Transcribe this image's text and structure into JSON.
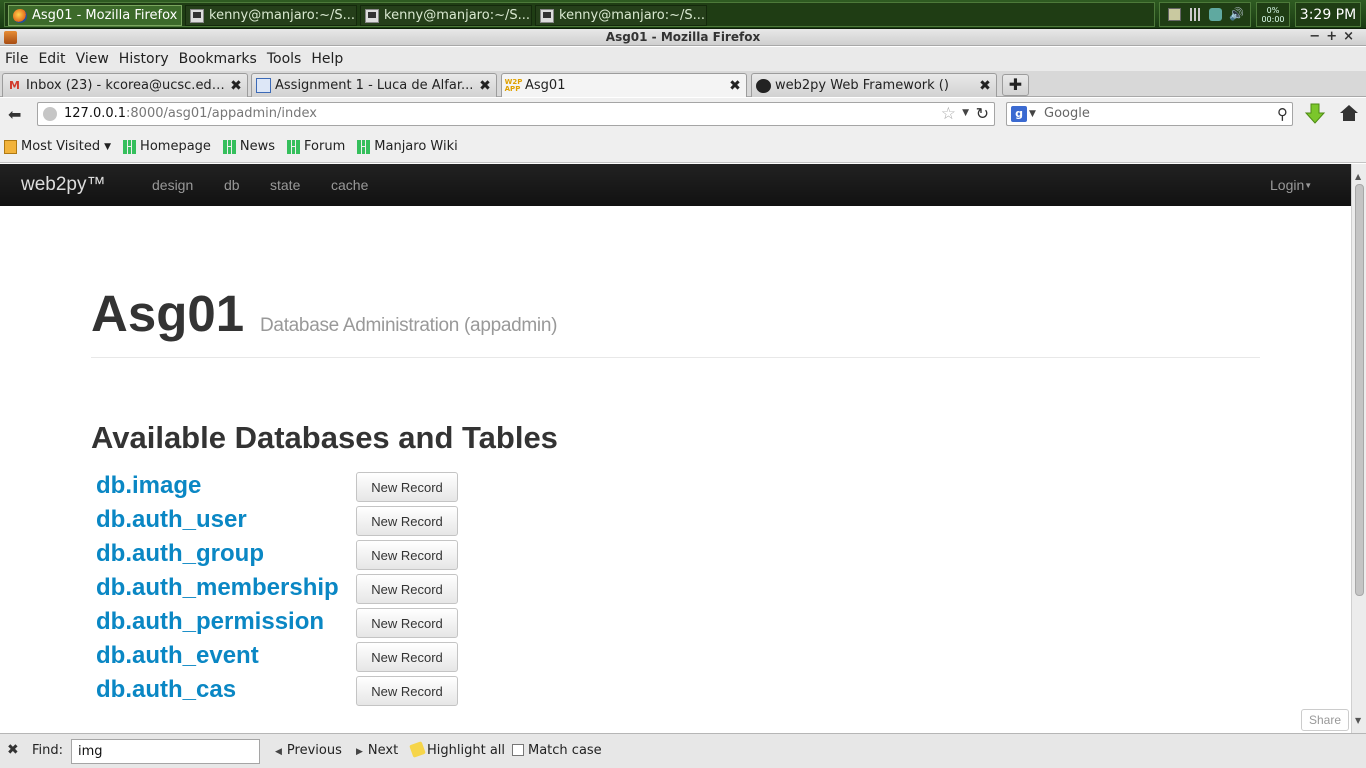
{
  "taskbar": {
    "tasks": [
      {
        "label": "Asg01 - Mozilla Firefox"
      },
      {
        "label": "kenny@manjaro:~/S..."
      },
      {
        "label": "kenny@manjaro:~/S..."
      },
      {
        "label": "kenny@manjaro:~/S..."
      }
    ],
    "load_top": "0%",
    "load_bottom": "00:00",
    "clock": "3:29 PM"
  },
  "window": {
    "title": "Asg01 - Mozilla Firefox",
    "controls": {
      "minimize": "−",
      "maximize": "+",
      "close": "×"
    }
  },
  "menubar": {
    "items": [
      "File",
      "Edit",
      "View",
      "History",
      "Bookmarks",
      "Tools",
      "Help"
    ]
  },
  "tabs": [
    {
      "label": "Inbox (23) - kcorea@ucsc.edu...",
      "icon": "gmail-icon"
    },
    {
      "label": "Assignment 1 - Luca de Alfar...",
      "icon": "document-icon"
    },
    {
      "label": "Asg01",
      "icon": "web2py-icon"
    },
    {
      "label": "web2py Web Framework ()",
      "icon": "github-icon"
    }
  ],
  "navbar": {
    "url_host": "127.0.0.1",
    "url_path": ":8000/asg01/appadmin/index",
    "search_placeholder": "Google"
  },
  "bookmarks": {
    "most_visited": "Most Visited",
    "items": [
      "Homepage",
      "News",
      "Forum",
      "Manjaro Wiki"
    ]
  },
  "webapp": {
    "brand": "web2py™",
    "nav": [
      "design",
      "db",
      "state",
      "cache"
    ],
    "login": "Login",
    "title": "Asg01",
    "subtitle": "Database Administration (appadmin)",
    "section_heading": "Available Databases and Tables",
    "new_record_label": "New Record",
    "tables": [
      "db.image",
      "db.auth_user",
      "db.auth_group",
      "db.auth_membership",
      "db.auth_permission",
      "db.auth_event",
      "db.auth_cas"
    ],
    "share": "Share"
  },
  "findbar": {
    "label": "Find:",
    "query": "img",
    "previous": "Previous",
    "next": "Next",
    "highlight_all": "Highlight all",
    "match_case": "Match case"
  },
  "colors": {
    "link": "#0a87c4",
    "navbar_bg": "#1b1b1b",
    "taskbar_bg": "#2a5020"
  }
}
